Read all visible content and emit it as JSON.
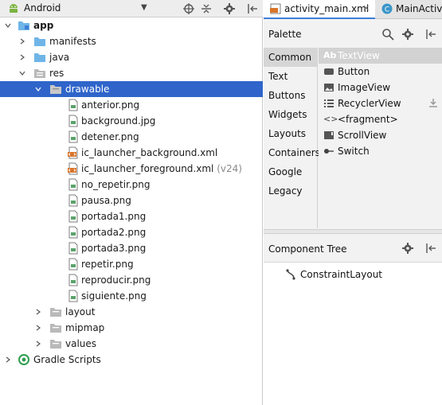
{
  "project_panel": {
    "view_type": "Android",
    "tree": [
      {
        "label": "app",
        "bold": true
      },
      {
        "label": "manifests"
      },
      {
        "label": "java"
      },
      {
        "label": "res"
      },
      {
        "label": "drawable",
        "selected": true
      },
      {
        "label": "anterior.png"
      },
      {
        "label": "background.jpg"
      },
      {
        "label": "detener.png"
      },
      {
        "label": "ic_launcher_background.xml"
      },
      {
        "label": "ic_launcher_foreground.xml",
        "suffix": "(v24)"
      },
      {
        "label": "no_repetir.png"
      },
      {
        "label": "pausa.png"
      },
      {
        "label": "portada1.png"
      },
      {
        "label": "portada2.png"
      },
      {
        "label": "portada3.png"
      },
      {
        "label": "repetir.png"
      },
      {
        "label": "reproducir.png"
      },
      {
        "label": "siguiente.png"
      },
      {
        "label": "layout"
      },
      {
        "label": "mipmap"
      },
      {
        "label": "values"
      },
      {
        "label": "Gradle Scripts"
      }
    ]
  },
  "editor_tabs": [
    {
      "label": "activity_main.xml",
      "active": true
    },
    {
      "label": "MainActiv"
    }
  ],
  "palette": {
    "title": "Palette",
    "categories": [
      "Common",
      "Text",
      "Buttons",
      "Widgets",
      "Layouts",
      "Containers",
      "Google",
      "Legacy"
    ],
    "selected_category": "Common",
    "items": [
      {
        "label": "TextView",
        "icon": "Ab",
        "selected": true
      },
      {
        "label": "Button",
        "icon": "button-icon"
      },
      {
        "label": "ImageView",
        "icon": "image-icon"
      },
      {
        "label": "RecyclerView",
        "icon": "list-icon"
      },
      {
        "label": "<fragment>",
        "icon": "<>"
      },
      {
        "label": "ScrollView",
        "icon": "scroll-icon"
      },
      {
        "label": "Switch",
        "icon": "switch-icon"
      }
    ]
  },
  "component_tree": {
    "title": "Component Tree",
    "root": "ConstraintLayout"
  },
  "colors": {
    "selection": "#2f65ca",
    "tab_accent": "#3c7fd8",
    "folder_blue": "#6fb5e8",
    "xml_orange": "#d9752b",
    "png_green": "#5aa36a",
    "android_green": "#7cb342"
  }
}
